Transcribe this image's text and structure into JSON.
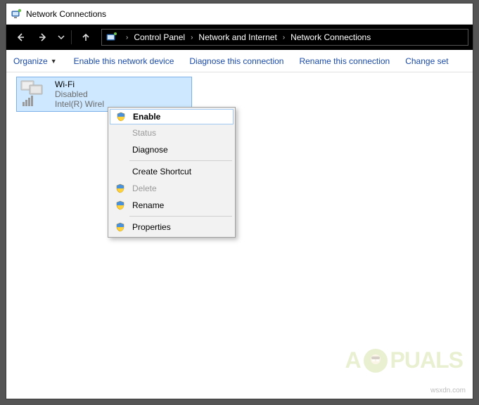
{
  "titlebar": {
    "title": "Network Connections"
  },
  "nav": {
    "breadcrumbs": [
      "Control Panel",
      "Network and Internet",
      "Network Connections"
    ]
  },
  "cmdbar": {
    "organize": "Organize",
    "items": [
      "Enable this network device",
      "Diagnose this connection",
      "Rename this connection",
      "Change set"
    ]
  },
  "adapter": {
    "name": "Wi-Fi",
    "status": "Disabled",
    "hardware": "Intel(R) Wirel"
  },
  "context_menu": {
    "items": [
      {
        "label": "Enable",
        "shield": true,
        "highlight": true,
        "disabled": false
      },
      {
        "label": "Status",
        "shield": false,
        "highlight": false,
        "disabled": true
      },
      {
        "label": "Diagnose",
        "shield": false,
        "highlight": false,
        "disabled": false
      },
      {
        "sep": true
      },
      {
        "label": "Create Shortcut",
        "shield": false,
        "highlight": false,
        "disabled": false
      },
      {
        "label": "Delete",
        "shield": true,
        "highlight": false,
        "disabled": true
      },
      {
        "label": "Rename",
        "shield": true,
        "highlight": false,
        "disabled": false
      },
      {
        "sep": true
      },
      {
        "label": "Properties",
        "shield": true,
        "highlight": false,
        "disabled": false
      }
    ]
  },
  "watermark": {
    "brand_left": "A",
    "brand_right": "PUALS",
    "credit": "wsxdn.com"
  }
}
